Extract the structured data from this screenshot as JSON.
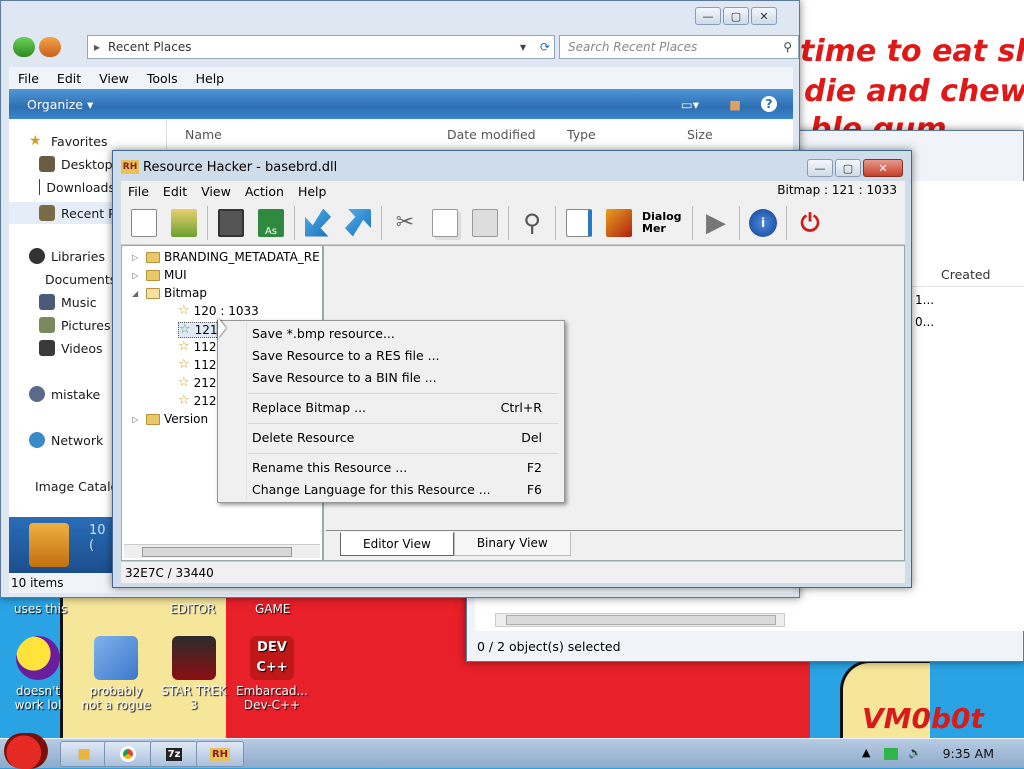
{
  "wallpaper": {
    "line1": "time to eat shit",
    "line2": "die and chew",
    "line3": "ble gum",
    "signature": "VM0b0t",
    "labels": [
      "uses this",
      "EDITOR",
      "GAME"
    ]
  },
  "desktop_icons": [
    {
      "label": "doesn't work lol",
      "icon": "yahoo-messenger-icon",
      "color": "#6a1e9e"
    },
    {
      "label": "probably not a rogue",
      "icon": "computer-gears-icon",
      "color": "#3c78c8"
    },
    {
      "label": "STAR TREK 3",
      "icon": "star-wars-game-icon",
      "color": "#8b0f12"
    },
    {
      "label": "Embarcad... Dev-C++",
      "icon": "dev-cpp-icon",
      "color": "#c01818"
    }
  ],
  "explorer": {
    "address": "Recent Places",
    "search_placeholder": "Search Recent Places",
    "menu": [
      "File",
      "Edit",
      "View",
      "Tools",
      "Help"
    ],
    "organize": "Organize",
    "columns": [
      "Name",
      "Date modified",
      "Type",
      "Size"
    ],
    "nav": [
      {
        "label": "Favorites",
        "icon": "favorites-star-icon"
      },
      {
        "label": "Desktop",
        "icon": "desktop-icon"
      },
      {
        "label": "Downloads",
        "icon": "downloads-icon"
      },
      {
        "label": "Recent Places",
        "icon": "recent-places-icon"
      },
      {
        "label": "Libraries",
        "icon": "libraries-icon"
      },
      {
        "label": "Documents",
        "icon": "documents-icon"
      },
      {
        "label": "Music",
        "icon": "music-icon"
      },
      {
        "label": "Pictures",
        "icon": "pictures-icon"
      },
      {
        "label": "Videos",
        "icon": "videos-icon"
      },
      {
        "label": "mistake",
        "icon": "homegroup-icon"
      },
      {
        "label": "Network",
        "icon": "network-icon"
      },
      {
        "label": "Image Catalog",
        "icon": "image-catalog-icon"
      }
    ],
    "details_count": "10 (",
    "status": "10 items"
  },
  "explorer2": {
    "column": "Created",
    "cells": [
      "1...",
      "0..."
    ],
    "status": "0 / 2 object(s) selected"
  },
  "rh": {
    "title": "Resource Hacker - basebrd.dll",
    "logo": "RH",
    "menu": [
      "File",
      "Edit",
      "View",
      "Action",
      "Help"
    ],
    "bitmap_info": "Bitmap : 121 : 1033",
    "toolbar_dialog_label": "Dialog Mer",
    "tree": {
      "branding": "BRANDING_METADATA_RE",
      "mui": "MUI",
      "bitmap": "Bitmap",
      "items": [
        "120 : 1033",
        "121",
        "112",
        "112",
        "212",
        "212"
      ],
      "version": "Version"
    },
    "tabs": [
      "Editor View",
      "Binary View"
    ],
    "status": "32E7C / 33440"
  },
  "context_menu": [
    {
      "label": "Save *.bmp resource...",
      "shortcut": ""
    },
    {
      "label": "Save Resource to a RES file ...",
      "shortcut": ""
    },
    {
      "label": "Save Resource to a BIN file ...",
      "shortcut": ""
    },
    {
      "label": "Replace Bitmap ...",
      "shortcut": "Ctrl+R"
    },
    {
      "label": "Delete Resource",
      "shortcut": "Del"
    },
    {
      "label": "Rename this Resource ...",
      "shortcut": "F2"
    },
    {
      "label": "Change Language for this Resource ...",
      "shortcut": "F6"
    }
  ],
  "taskbar": {
    "start_icon": "angry-bird-start-icon",
    "buttons": [
      {
        "label": "",
        "icon": "explorer-folder-icon"
      },
      {
        "label": "",
        "icon": "chrome-icon"
      },
      {
        "label": "7z",
        "icon": "7zip-icon"
      },
      {
        "label": "RH",
        "icon": "resource-hacker-icon"
      }
    ],
    "clock": "9:35 AM"
  }
}
